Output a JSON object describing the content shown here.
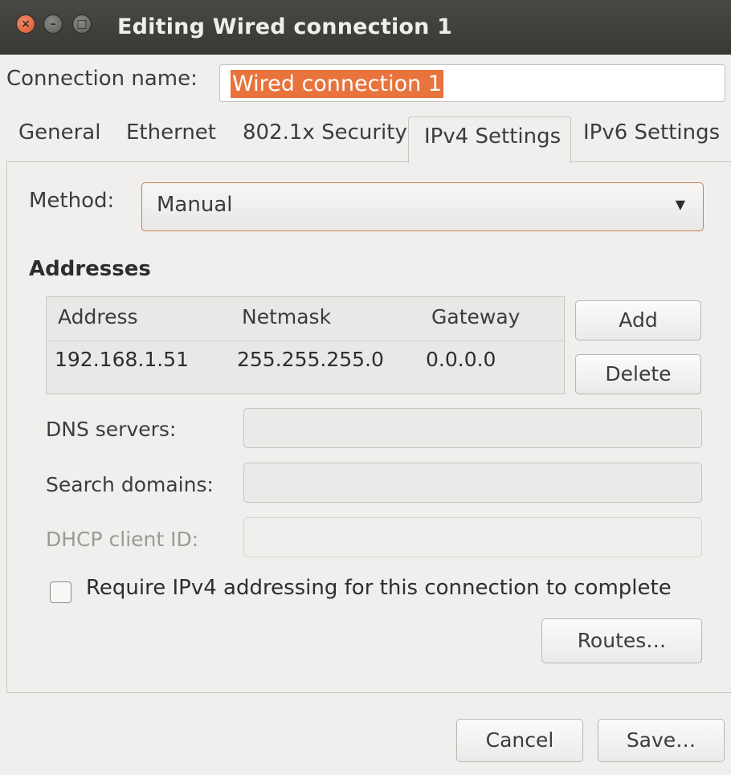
{
  "window": {
    "title": "Editing Wired connection 1",
    "close_glyph": "×",
    "minimize_glyph": "–",
    "maximize_glyph": "□"
  },
  "connection_name": {
    "label": "Connection name:",
    "value": "Wired connection 1"
  },
  "tabs": [
    {
      "label": "General",
      "active": false
    },
    {
      "label": "Ethernet",
      "active": false
    },
    {
      "label": "802.1x Security",
      "active": false
    },
    {
      "label": "IPv4 Settings",
      "active": true
    },
    {
      "label": "IPv6 Settings",
      "active": false
    }
  ],
  "ipv4": {
    "method_label": "Method:",
    "method_value": "Manual",
    "addresses_heading": "Addresses",
    "addresses": {
      "columns": [
        "Address",
        "Netmask",
        "Gateway"
      ],
      "rows": [
        [
          "192.168.1.51",
          "255.255.255.0",
          "0.0.0.0"
        ]
      ]
    },
    "add_label": "Add",
    "delete_label": "Delete",
    "dns_label": "DNS servers:",
    "dns_value": "",
    "search_label": "Search domains:",
    "search_value": "",
    "dhcp_label": "DHCP client ID:",
    "dhcp_value": "",
    "require_label": "Require IPv4 addressing for this connection to complete",
    "require_checked": false,
    "routes_label": "Routes…"
  },
  "footer": {
    "cancel_label": "Cancel",
    "save_label": "Save…"
  },
  "colors": {
    "selection": "#e9733c",
    "titlebar": "#3e3c39",
    "close_button": "#e0613a"
  },
  "icons": {
    "close": "close-icon",
    "minimize": "minimize-icon",
    "maximize": "maximize-icon",
    "dropdown": "chevron-down-icon"
  }
}
